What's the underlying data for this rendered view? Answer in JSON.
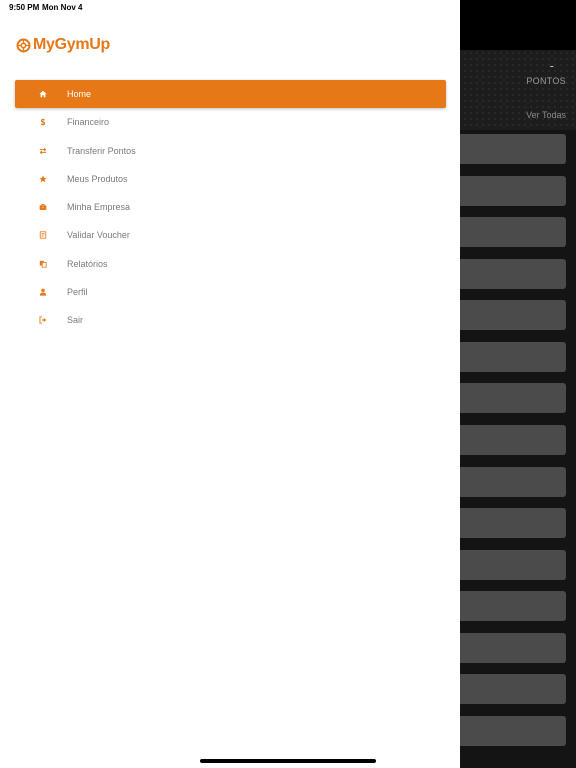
{
  "status_bar": {
    "time": "9:50 PM",
    "date": "Mon Nov 4"
  },
  "brand": {
    "name": "MyGymUp",
    "accent": "#e67817"
  },
  "background": {
    "points_value": "-",
    "points_label": "PONTOS",
    "see_all": "Ver Todas",
    "card_color": "#4b4b4b"
  },
  "menu": [
    {
      "label": "Home",
      "icon": "home-icon",
      "active": true
    },
    {
      "label": "Financeiro",
      "icon": "dollar-icon",
      "active": false
    },
    {
      "label": "Transferir Pontos",
      "icon": "transfer-arrows-icon",
      "active": false
    },
    {
      "label": "Meus Produtos",
      "icon": "star-icon",
      "active": false
    },
    {
      "label": "Minha Empresa",
      "icon": "briefcase-icon",
      "active": false
    },
    {
      "label": "Validar Voucher",
      "icon": "voucher-icon",
      "active": false
    },
    {
      "label": "Relatórios",
      "icon": "copy-icon",
      "active": false
    },
    {
      "label": "Perfil",
      "icon": "user-icon",
      "active": false
    },
    {
      "label": "Sair",
      "icon": "sign-out-icon",
      "active": false
    }
  ]
}
